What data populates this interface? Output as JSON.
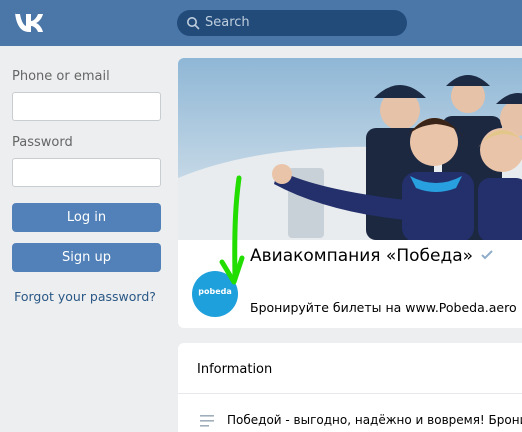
{
  "header": {
    "logo_text": "VK",
    "search_placeholder": "Search"
  },
  "login": {
    "phone_label": "Phone or email",
    "phone_value": "",
    "password_label": "Password",
    "password_value": "",
    "login_button": "Log in",
    "signup_button": "Sign up",
    "forgot_link": "Forgot your password?"
  },
  "community": {
    "name": "Авиакомпания «Победа»",
    "status": "Бронируйте билеты на www.Pobeda.aero",
    "avatar_text": "pobeda",
    "verified_icon": "verified-checkmark-icon",
    "annotation": "green hand-drawn arrow pointing to avatar"
  },
  "info": {
    "heading": "Information",
    "description": "Победой - выгодно, надёжно и вовремя! Бронир"
  },
  "colors": {
    "topbar": "#4a76a8",
    "button": "#5181b8",
    "link": "#2a5885",
    "background": "#edeef0",
    "arrow": "#22dd00"
  }
}
